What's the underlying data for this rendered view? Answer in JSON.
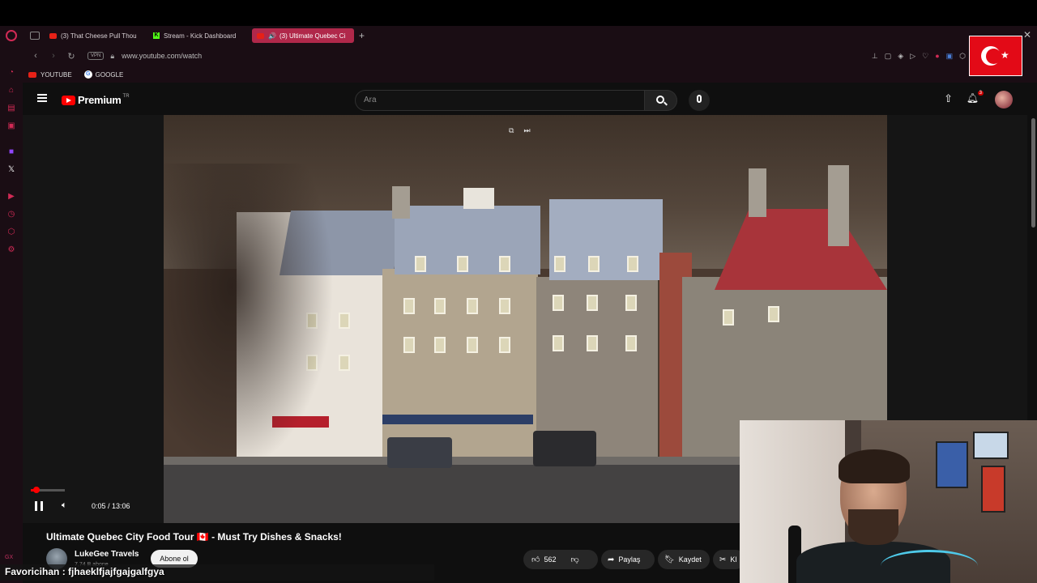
{
  "browser": {
    "tabs": [
      {
        "label": "(3) That Cheese Pull Thou",
        "icon": "youtube-icon"
      },
      {
        "label": "Stream - Kick Dashboard",
        "icon": "kick-icon"
      },
      {
        "label": "(3) Ultimate Quebec Ci",
        "icon": "youtube-icon",
        "active": true
      }
    ],
    "url": "www.youtube.com/watch",
    "vpn_label": "VPN",
    "bookmarks": [
      {
        "label": "YOUTUBE",
        "icon": "youtube-icon"
      },
      {
        "label": "GOOGLE",
        "icon": "google-icon"
      }
    ],
    "sidebar_badge": "GX"
  },
  "youtube": {
    "logo_text": "Premium",
    "logo_region": "TR",
    "search_placeholder": "Ara",
    "notification_count": "3",
    "player": {
      "time": "0:05 / 13:06",
      "progress_fraction": 0.006
    },
    "video": {
      "title": "Ultimate Quebec City Food Tour 🇨🇦 - Must Try Dishes & Snacks!",
      "channel": "LukeGee Travels",
      "subscribers": "7,74 B abone",
      "subscribe_label": "Abone ol",
      "likes": "562",
      "share_label": "Paylaş",
      "save_label": "Kaydet",
      "clip_label": "Kl"
    }
  },
  "stream_overlay": {
    "chat_line": "Favoricihan : fjhaeklfjajfgajgalfgya"
  },
  "colors": {
    "accent": "#d12a55",
    "youtube_red": "#ff0000",
    "active_tab": "#b0284a"
  }
}
